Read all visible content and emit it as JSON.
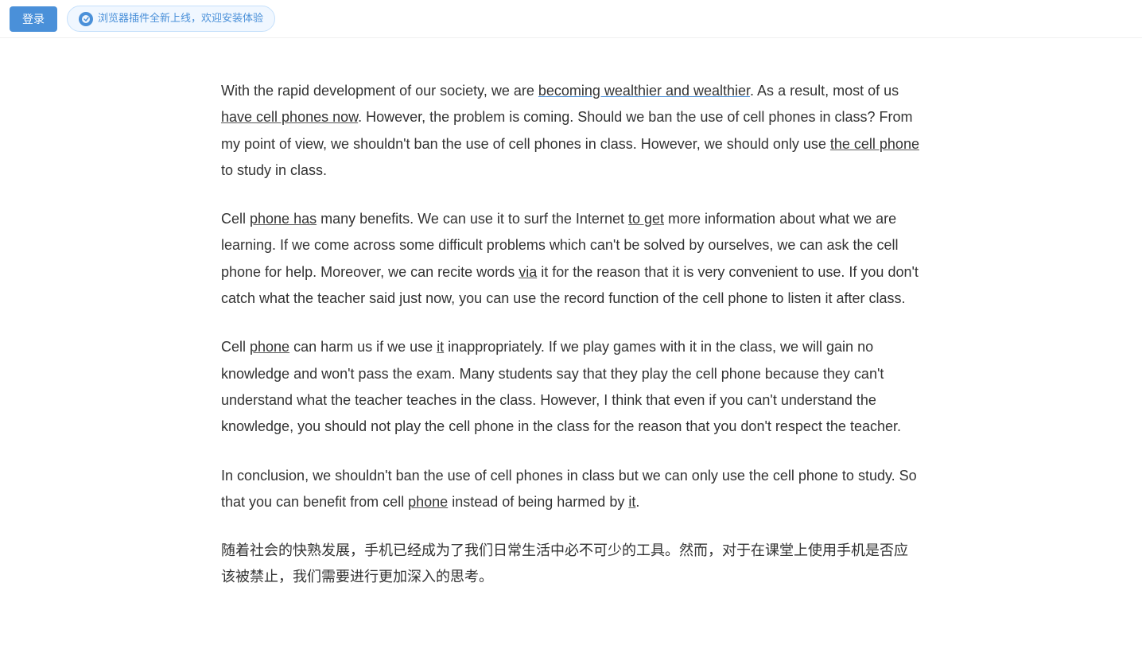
{
  "topbar": {
    "login_label": "登录",
    "plugin_label": "浏览器插件全新上线，欢迎安装体验"
  },
  "article": {
    "paragraphs": [
      {
        "id": "p1",
        "text_parts": [
          {
            "text": "With the rapid development of our society, we are ",
            "style": "normal"
          },
          {
            "text": "becoming wealthier and wealthier",
            "style": "underline-blue"
          },
          {
            "text": ". As a result, most of us ",
            "style": "normal"
          },
          {
            "text": "have cell phones now",
            "style": "underline-dark"
          },
          {
            "text": ". However, the problem is coming. Should we ban the use of cell phones in class? From my point of view, we shouldn’t ban the use of cell phones in class. However, we should only use ",
            "style": "normal"
          },
          {
            "text": "the cell phone",
            "style": "underline-dark"
          },
          {
            "text": " to study in class.",
            "style": "normal"
          }
        ]
      },
      {
        "id": "p2",
        "text_parts": [
          {
            "text": "Cell ",
            "style": "normal"
          },
          {
            "text": "phone has",
            "style": "underline-dark"
          },
          {
            "text": " many benefits. We can use it to surf the Internet ",
            "style": "normal"
          },
          {
            "text": "to get",
            "style": "underline-dark"
          },
          {
            "text": " more information about what we are learning. If we come across some difficult problems which can’t be solved by ourselves, we can ask the cell phone for help. Moreover, we can recite words ",
            "style": "normal"
          },
          {
            "text": "via",
            "style": "underline-dark"
          },
          {
            "text": " it for the reason that it is very convenient to use. If you don’t catch what the teacher said just now, you can use the record function of the cell phone to listen it after class.",
            "style": "normal"
          }
        ]
      },
      {
        "id": "p3",
        "text_parts": [
          {
            "text": "Cell ",
            "style": "normal"
          },
          {
            "text": "phone",
            "style": "underline-dark"
          },
          {
            "text": " can harm us if we use ",
            "style": "normal"
          },
          {
            "text": "it",
            "style": "underline-dark"
          },
          {
            "text": " inappropriately. If we play games with it in the class, we will gain no knowledge and won’t pass the exam. Many students say that they play the cell phone because they can’t understand what the teacher teaches in the class. However, I think that even if you can’t understand the knowledge, you should not play the cell phone in the class for the reason that you don’t respect the teacher.",
            "style": "normal"
          }
        ]
      },
      {
        "id": "p4",
        "text_parts": [
          {
            "text": "In conclusion, we shouldn’t ban the use of cell phones in class but we can only use the cell phone to study. So that you can benefit from cell ",
            "style": "normal"
          },
          {
            "text": "phone",
            "style": "underline-dark"
          },
          {
            "text": " instead of being harmed by ",
            "style": "normal"
          },
          {
            "text": "it",
            "style": "underline-dark"
          },
          {
            "text": ".",
            "style": "normal"
          }
        ]
      },
      {
        "id": "p5_chinese",
        "text": "随着社会的快熟发展，手机已经成为了我们日常生活中必不可少的工具。然而，对于在课堂上使用手机是否应该被禁止，我们需要进行更加深入的思考。",
        "style": "chinese"
      }
    ]
  }
}
